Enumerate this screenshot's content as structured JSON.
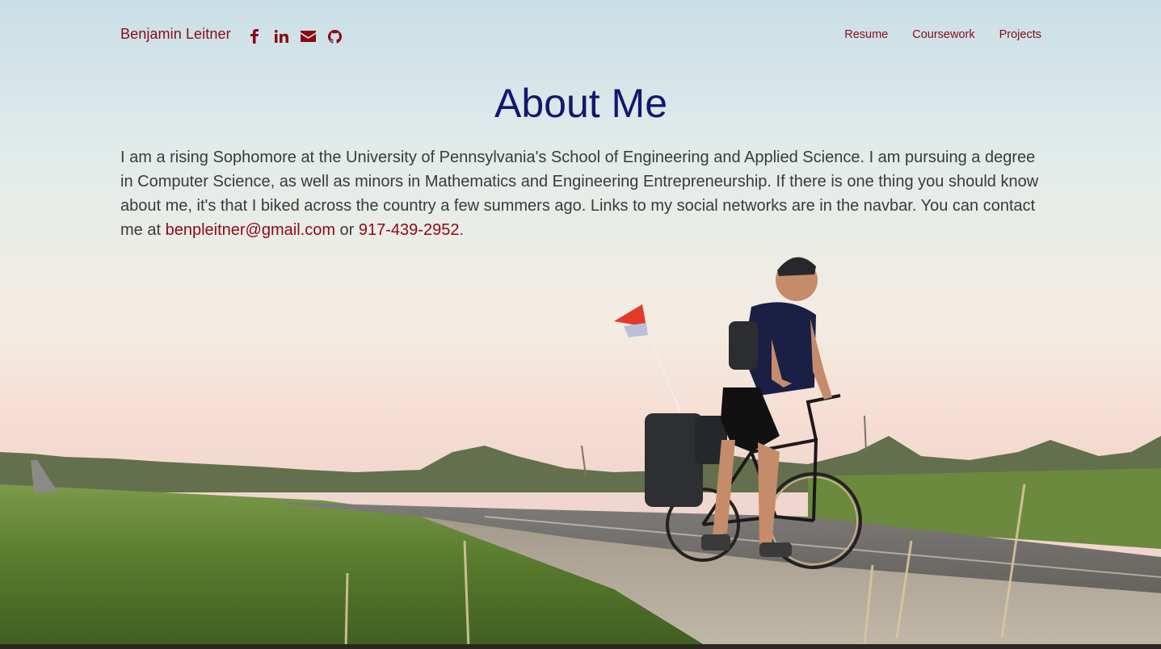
{
  "navbar": {
    "brand": "Benjamin Leitner",
    "social_icons": [
      "facebook-icon",
      "linkedin-icon",
      "envelope-icon",
      "github-icon"
    ],
    "links": [
      "Resume",
      "Coursework",
      "Projects"
    ]
  },
  "main": {
    "title": "About Me",
    "paragraph_text": "I am a rising Sophomore at the University of Pennsylvania's School of Engineering and Applied Science. I am pursuing a degree in Computer Science, as well as minors in Mathematics and Engineering Entrepreneurship. If there is one thing you should know about me, it's that I biked across the country a few summers ago. Links to my social networks are in the navbar. You can contact me at ",
    "email": "benpleitner@gmail.com",
    "connector": " or ",
    "phone": "917-439-2952",
    "end": "."
  },
  "colors": {
    "accent": "#8b0a15",
    "title": "#15166e",
    "text": "#3a3a3a"
  }
}
